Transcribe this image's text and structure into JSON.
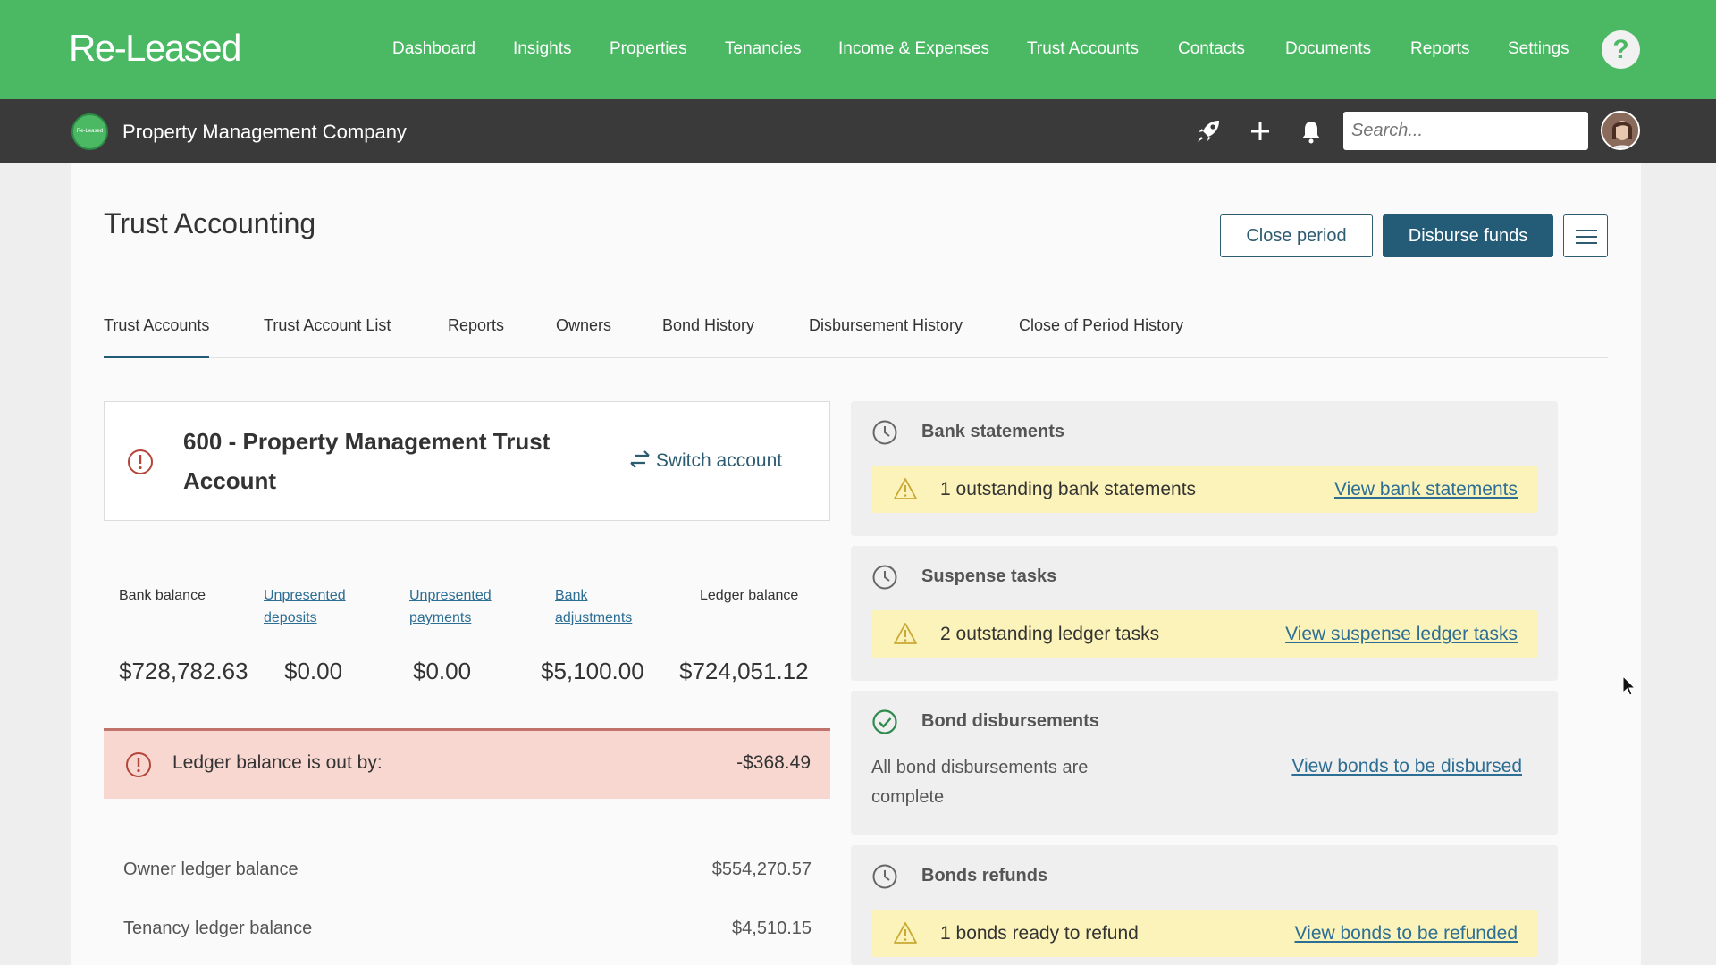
{
  "brand": {
    "logo": "Re-Leased",
    "org_logo_text": "Re-Leased",
    "org_name": "Property Management Company"
  },
  "nav": [
    {
      "label": "Dashboard"
    },
    {
      "label": "Insights"
    },
    {
      "label": "Properties"
    },
    {
      "label": "Tenancies"
    },
    {
      "label": "Income & Expenses"
    },
    {
      "label": "Trust Accounts"
    },
    {
      "label": "Contacts"
    },
    {
      "label": "Documents"
    },
    {
      "label": "Reports"
    },
    {
      "label": "Settings"
    }
  ],
  "help_label": "?",
  "search": {
    "placeholder": "Search..."
  },
  "page": {
    "title": "Trust Accounting",
    "close_period": "Close period",
    "disburse_funds": "Disburse funds"
  },
  "tabs": [
    {
      "label": "Trust Accounts",
      "active": true
    },
    {
      "label": "Trust Account List"
    },
    {
      "label": "Reports"
    },
    {
      "label": "Owners"
    },
    {
      "label": "Bond History"
    },
    {
      "label": "Disbursement History"
    },
    {
      "label": "Close of Period History"
    }
  ],
  "account": {
    "title": "600 - Property Management Trust Account",
    "switch_label": "Switch account"
  },
  "balances": {
    "headers": {
      "bank_balance": "Bank balance",
      "unpresented_deposits_1": "Unpresented",
      "unpresented_deposits_2": "deposits",
      "unpresented_payments_1": "Unpresented",
      "unpresented_payments_2": "payments",
      "bank_adjustments_1": "Bank",
      "bank_adjustments_2": "adjustments",
      "ledger_balance": "Ledger balance"
    },
    "values": {
      "bank_balance": "$728,782.63",
      "unpresented_deposits": "$0.00",
      "unpresented_payments": "$0.00",
      "bank_adjustments": "$5,100.00",
      "ledger_balance": "$724,051.12"
    }
  },
  "out_by": {
    "label": "Ledger balance is out by:",
    "value": "-$368.49"
  },
  "ledgers": [
    {
      "label": "Owner ledger balance",
      "value": "$554,270.57"
    },
    {
      "label": "Tenancy ledger balance",
      "value": "$4,510.15"
    }
  ],
  "panels": {
    "bank_statements": {
      "title": "Bank statements",
      "alert": "1 outstanding bank statements",
      "link": "View bank statements"
    },
    "suspense_tasks": {
      "title": "Suspense tasks",
      "alert": "2 outstanding ledger tasks",
      "link": "View suspense ledger tasks"
    },
    "bond_disbursements": {
      "title": "Bond disbursements",
      "text_1": "All bond disbursements are",
      "text_2": "complete",
      "link": "View bonds to be disbursed"
    },
    "bonds_refunds": {
      "title": "Bonds refunds",
      "alert": "1 bonds ready to refund",
      "link": "View bonds to be refunded"
    }
  },
  "colors": {
    "brand_green": "#4bb964",
    "dark_bar": "#3a3a3a",
    "primary_blue": "#245c78",
    "alert_yellow": "#fbf3b9",
    "error_pink": "#f8d7d0"
  }
}
